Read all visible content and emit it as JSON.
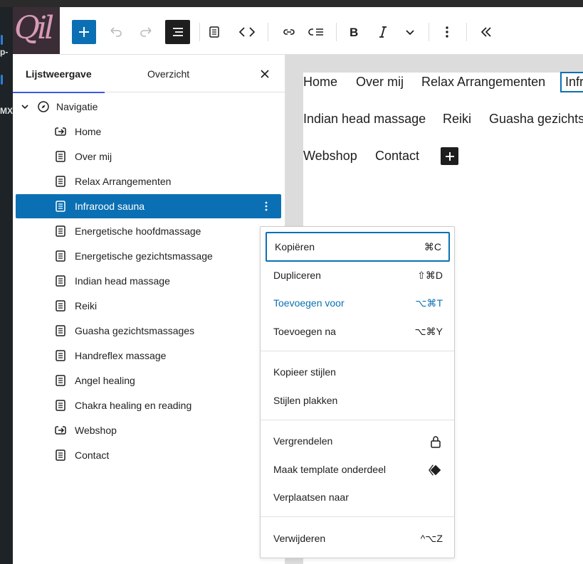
{
  "browser_strip": {
    "fragments": [
      "",
      "",
      "",
      ""
    ]
  },
  "left_sliver": {
    "labels": [
      "p-",
      "p-",
      "MX"
    ]
  },
  "logo": {
    "text": "Qil"
  },
  "toolbar": {
    "buttons": [
      {
        "name": "add-block-button",
        "icon": "plus-icon"
      },
      {
        "name": "undo-button",
        "icon": "undo-icon"
      },
      {
        "name": "redo-button",
        "icon": "redo-icon"
      },
      {
        "name": "list-view-button",
        "icon": "list-view-icon"
      },
      {
        "name": "document-overview-button",
        "icon": "document-icon"
      },
      {
        "name": "code-button",
        "icon": "code-icon"
      },
      {
        "name": "link-button",
        "icon": "link-icon"
      },
      {
        "name": "add-submenu-button",
        "icon": "submenu-icon"
      },
      {
        "name": "bold-button",
        "icon": "bold-icon"
      },
      {
        "name": "italic-button",
        "icon": "italic-icon"
      },
      {
        "name": "more-rich-text-button",
        "icon": "chevron-down-icon"
      },
      {
        "name": "options-button",
        "icon": "more-vertical-icon"
      },
      {
        "name": "collapse-button",
        "icon": "chevrons-left-icon"
      }
    ]
  },
  "panel": {
    "tabs": [
      {
        "label": "Lijstweergave",
        "active": true
      },
      {
        "label": "Overzicht",
        "active": false
      }
    ],
    "close_icon": "close-icon",
    "root": {
      "label": "Navigatie",
      "icon": "compass-icon"
    },
    "items": [
      {
        "label": "Home",
        "icon": "custom-link-icon"
      },
      {
        "label": "Over mij",
        "icon": "page-icon"
      },
      {
        "label": "Relax Arrangementen",
        "icon": "page-icon"
      },
      {
        "label": "Infrarood sauna",
        "icon": "page-icon",
        "selected": true
      },
      {
        "label": "Energetische hoofdmassage",
        "icon": "page-icon"
      },
      {
        "label": "Energetische gezichtsmassage",
        "icon": "page-icon"
      },
      {
        "label": "Indian head massage",
        "icon": "page-icon"
      },
      {
        "label": "Reiki",
        "icon": "page-icon"
      },
      {
        "label": "Guasha gezichtsmassages",
        "icon": "page-icon"
      },
      {
        "label": "Handreflex massage",
        "icon": "page-icon"
      },
      {
        "label": "Angel healing",
        "icon": "page-icon"
      },
      {
        "label": "Chakra healing en reading",
        "icon": "page-icon"
      },
      {
        "label": "Webshop",
        "icon": "custom-link-icon"
      },
      {
        "label": "Contact",
        "icon": "page-icon"
      }
    ]
  },
  "canvas": {
    "links": [
      "Home",
      "Over mij",
      "Relax Arrangementen",
      "Infr",
      "Indian head massage",
      "Reiki",
      "Guasha gezichts",
      "Webshop",
      "Contact"
    ]
  },
  "menu": {
    "groups": [
      [
        {
          "label": "Kopiëren",
          "shortcut": "⌘C",
          "focused": true
        },
        {
          "label": "Dupliceren",
          "shortcut": "⇧⌘D"
        },
        {
          "label": "Toevoegen voor",
          "shortcut": "⌥⌘T",
          "highlight": true
        },
        {
          "label": "Toevoegen na",
          "shortcut": "⌥⌘Y"
        }
      ],
      [
        {
          "label": "Kopieer stijlen",
          "shortcut": ""
        },
        {
          "label": "Stijlen plakken",
          "shortcut": ""
        }
      ],
      [
        {
          "label": "Vergrendelen",
          "icon": "lock-icon"
        },
        {
          "label": "Maak template onderdeel",
          "icon": "diamond-icon"
        },
        {
          "label": "Verplaatsen naar",
          "shortcut": ""
        }
      ],
      [
        {
          "label": "Verwijderen",
          "shortcut": "^⌥Z"
        }
      ]
    ]
  },
  "colors": {
    "accent": "#0b70b3",
    "toolbar_primary": "#0b70b3",
    "text": "#1e1e1e"
  }
}
